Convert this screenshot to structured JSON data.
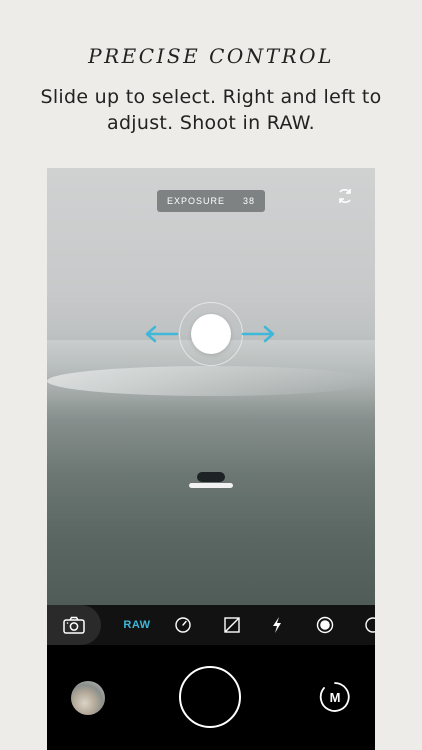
{
  "header": {
    "title": "PRECISE CONTROL",
    "subtitle": "Slide up to select. Right and left to adjust. Shoot in RAW."
  },
  "viewfinder": {
    "exposure_label": "EXPOSURE",
    "exposure_value": "38"
  },
  "toolbar": {
    "raw_label": "RAW",
    "accent_color": "#3fb7d8",
    "icons": [
      "camera-icon",
      "timer-icon",
      "exposure-icon",
      "flash-icon",
      "record-icon",
      "more-icon"
    ]
  },
  "controls": {
    "mode_label": "M"
  }
}
